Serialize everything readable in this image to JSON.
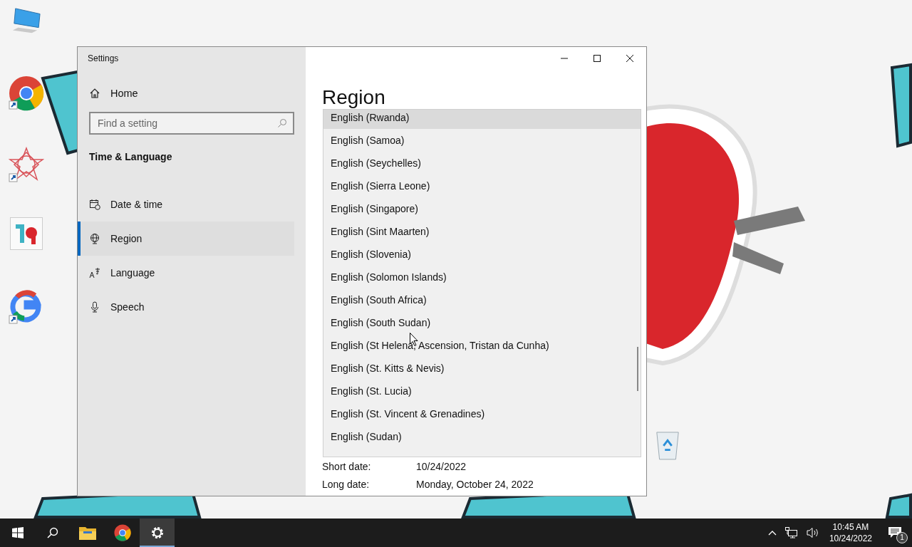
{
  "window": {
    "title": "Settings"
  },
  "sidebar": {
    "home": "Home",
    "search": {
      "placeholder": "Find a setting"
    },
    "section": "Time & Language",
    "items": [
      {
        "label": "Date & time",
        "kind": "date",
        "selected": false
      },
      {
        "label": "Region",
        "kind": "region",
        "selected": true
      },
      {
        "label": "Language",
        "kind": "language",
        "selected": false
      },
      {
        "label": "Speech",
        "kind": "speech",
        "selected": false
      }
    ]
  },
  "content": {
    "heading": "Region",
    "country_list": [
      {
        "label": "English (Rwanda)",
        "selected": true
      },
      {
        "label": "English (Samoa)",
        "selected": false
      },
      {
        "label": "English (Seychelles)",
        "selected": false
      },
      {
        "label": "English (Sierra Leone)",
        "selected": false
      },
      {
        "label": "English (Singapore)",
        "selected": false
      },
      {
        "label": "English (Sint Maarten)",
        "selected": false
      },
      {
        "label": "English (Slovenia)",
        "selected": false
      },
      {
        "label": "English (Solomon Islands)",
        "selected": false
      },
      {
        "label": "English (South Africa)",
        "selected": false
      },
      {
        "label": "English (South Sudan)",
        "selected": false
      },
      {
        "label": "English (St Helena, Ascension, Tristan da Cunha)",
        "selected": false
      },
      {
        "label": "English (St. Kitts & Nevis)",
        "selected": false
      },
      {
        "label": "English (St. Lucia)",
        "selected": false
      },
      {
        "label": "English (St. Vincent & Grenadines)",
        "selected": false
      },
      {
        "label": "English (Sudan)",
        "selected": false
      }
    ],
    "formats": [
      {
        "label": "Short date:",
        "value": "10/24/2022"
      },
      {
        "label": "Long date:",
        "value": "Monday, October 24, 2022"
      }
    ]
  },
  "taskbar": {
    "buttons": [
      {
        "kind": "start",
        "selected": false
      },
      {
        "kind": "search",
        "selected": false
      },
      {
        "kind": "folder",
        "selected": false
      },
      {
        "kind": "chrome",
        "selected": false
      },
      {
        "kind": "settings",
        "selected": true
      }
    ],
    "time": "10:45 AM",
    "date": "10/24/2022",
    "notifications": "1"
  }
}
